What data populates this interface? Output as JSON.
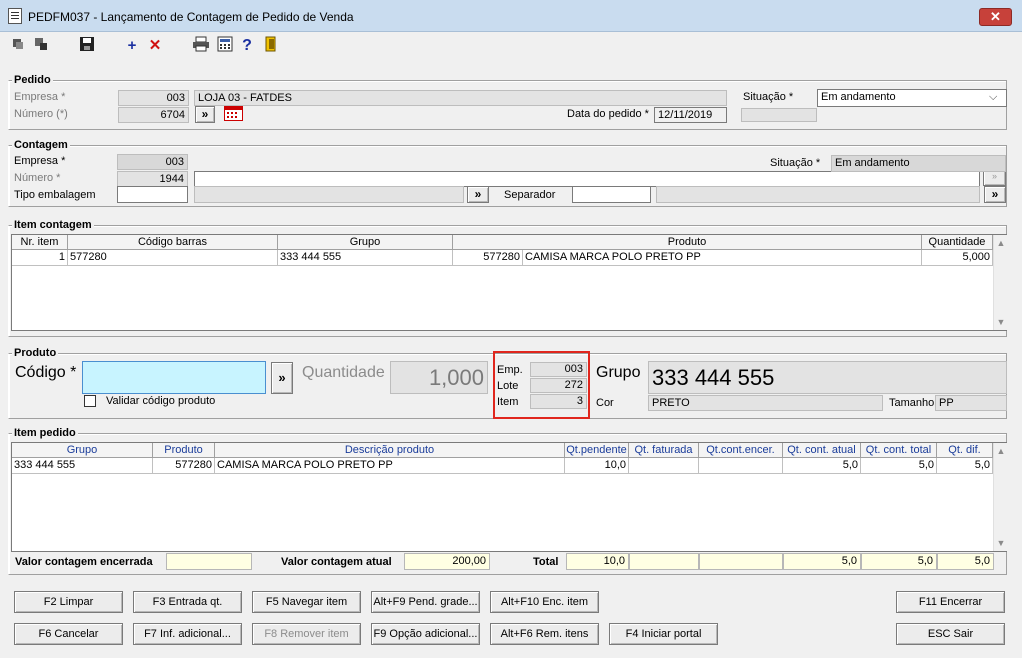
{
  "window": {
    "title": "PEDFM037 - Lançamento de Contagem de Pedido de Venda",
    "close": "✕"
  },
  "icons": {
    "toolbar": [
      "nav-first-icon",
      "nav-copy-icon",
      "save-icon",
      "add-icon",
      "delete-icon",
      "print-icon",
      "calculator-icon",
      "help-icon",
      "exit-icon"
    ]
  },
  "pedido": {
    "legend": "Pedido",
    "empresa_label": "Empresa *",
    "empresa_code": "003",
    "empresa_name": "LOJA 03 - FATDES",
    "numero_label": "Número (*)",
    "numero_value": "6704",
    "nav_btn": "»",
    "data_label": "Data do pedido *",
    "data_value": "12/11/2019",
    "situacao_label": "Situação *",
    "situacao_value": "Em andamento"
  },
  "contagem": {
    "legend": "Contagem",
    "empresa_label": "Empresa *",
    "empresa_code": "003",
    "numero_label": "Número *",
    "numero_value": "1944",
    "tipo_label": "Tipo embalagem",
    "separador_label": "Separador",
    "situacao_label": "Situação *",
    "situacao_value": "Em andamento",
    "nav_btn": "»"
  },
  "item_contagem": {
    "legend": "Item contagem",
    "columns": [
      "Nr. item",
      "Código barras",
      "Grupo",
      "Produto",
      "Quantidade"
    ],
    "rows": [
      {
        "nr": "1",
        "codigo": "577280",
        "grupo": "333 444 555",
        "produto_code": "577280",
        "produto_desc": "CAMISA MARCA POLO PRETO PP",
        "qtd": "5,000"
      }
    ]
  },
  "produto": {
    "legend": "Produto",
    "codigo_label": "Código *",
    "codigo_value": "",
    "nav_btn": "»",
    "validar_label": "Validar código produto",
    "quantidade_label": "Quantidade",
    "quantidade_value": "1,000",
    "emp_label": "Emp.",
    "emp_value": "003",
    "lote_label": "Lote",
    "lote_value": "272",
    "item_label": "Item",
    "item_value": "3",
    "grupo_label": "Grupo",
    "grupo_value": "333 444 555",
    "cor_label": "Cor",
    "cor_value": "PRETO",
    "tamanho_label": "Tamanho",
    "tamanho_value": "PP"
  },
  "item_pedido": {
    "legend": "Item pedido",
    "columns": [
      "Grupo",
      "Produto",
      "Descrição produto",
      "Qt.pendente",
      "Qt. faturada",
      "Qt.cont.encer.",
      "Qt. cont. atual",
      "Qt. cont. total",
      "Qt. dif."
    ],
    "rows": [
      {
        "grupo": "333 444 555",
        "produto": "577280",
        "descricao": "CAMISA MARCA POLO PRETO PP",
        "pendente": "10,0",
        "faturada": "",
        "encer": "",
        "atual": "5,0",
        "total": "5,0",
        "dif": "5,0"
      }
    ],
    "valor_encerrada_label": "Valor contagem encerrada",
    "valor_encerrada_value": "",
    "valor_atual_label": "Valor contagem atual",
    "valor_atual_value": "200,00",
    "total_label": "Total",
    "totals": {
      "pendente": "10,0",
      "faturada": "",
      "encer": "",
      "atual": "5,0",
      "total": "5,0",
      "dif": "5,0"
    }
  },
  "buttons": {
    "f2": "F2 Limpar",
    "f3": "F3 Entrada qt.",
    "f5": "F5 Navegar item",
    "altf9": "Alt+F9 Pend. grade...",
    "altf10": "Alt+F10 Enc. item",
    "f11": "F11 Encerrar",
    "f6": "F6 Cancelar",
    "f7": "F7 Inf. adicional...",
    "f8": "F8 Remover item",
    "f9": "F9 Opção adicional...",
    "altf6": "Alt+F6 Rem. itens",
    "f4": "F4 Iniciar portal",
    "esc": "ESC Sair"
  }
}
